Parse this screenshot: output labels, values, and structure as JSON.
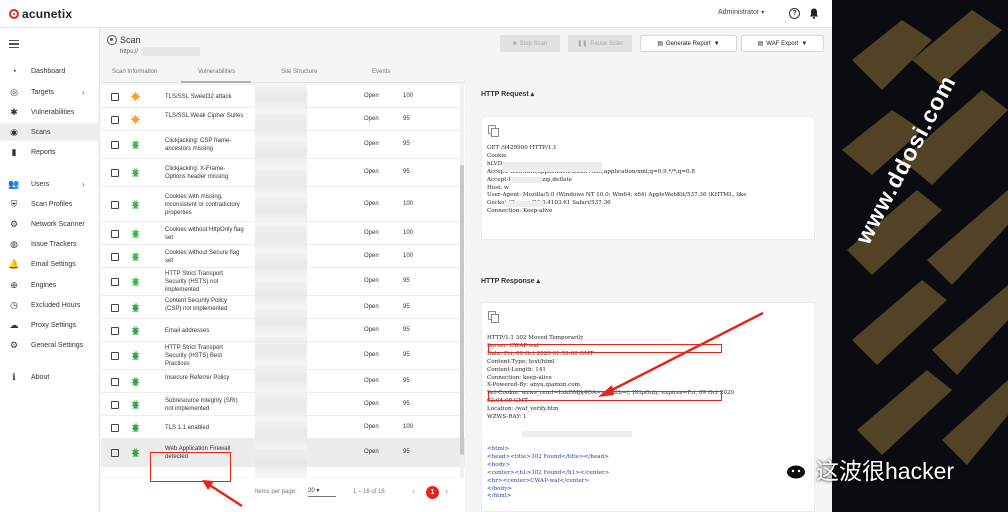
{
  "app": {
    "brand": "acunetix",
    "user": "Administrator",
    "help_glyph": "?"
  },
  "sidebar": {
    "items": [
      {
        "label": "Dashboard",
        "icon": "dashboard-icon",
        "glyph": "◔",
        "chevron": ""
      },
      {
        "label": "Targets",
        "icon": "target-icon",
        "glyph": "◎",
        "chevron": "›"
      },
      {
        "label": "Vulnerabilities",
        "icon": "bug-icon",
        "glyph": "✱",
        "chevron": ""
      },
      {
        "label": "Scans",
        "icon": "radar-icon",
        "glyph": "◉",
        "chevron": "",
        "active": true
      },
      {
        "label": "Reports",
        "icon": "report-icon",
        "glyph": "▮",
        "chevron": ""
      },
      {
        "label": "Users",
        "icon": "users-icon",
        "glyph": "👥",
        "chevron": "›"
      },
      {
        "label": "Scan Profiles",
        "icon": "shield-icon",
        "glyph": "⛨",
        "chevron": ""
      },
      {
        "label": "Network Scanner",
        "icon": "network-icon",
        "glyph": "⚙",
        "chevron": ""
      },
      {
        "label": "Issue Trackers",
        "icon": "issue-icon",
        "glyph": "◍",
        "chevron": ""
      },
      {
        "label": "Email Settings",
        "icon": "bell-icon",
        "glyph": "🔔",
        "chevron": ""
      },
      {
        "label": "Engines",
        "icon": "globe-icon",
        "glyph": "⊕",
        "chevron": ""
      },
      {
        "label": "Excluded Hours",
        "icon": "clock-icon",
        "glyph": "◷",
        "chevron": ""
      },
      {
        "label": "Proxy Settings",
        "icon": "cloud-icon",
        "glyph": "☁",
        "chevron": ""
      },
      {
        "label": "General Settings",
        "icon": "gear-icon",
        "glyph": "⚙",
        "chevron": ""
      },
      {
        "label": "About",
        "icon": "info-icon",
        "glyph": "ℹ",
        "chevron": ""
      }
    ]
  },
  "header": {
    "title": "Scan",
    "url_prefix": "https://",
    "buttons": {
      "stop_scan": "Stop Scan",
      "pause_scan": "Pause Scan",
      "generate_report": "Generate Report",
      "waf_export": "WAF Export"
    }
  },
  "tabs": [
    "Scan Information",
    "Vulnerabilities",
    "Site Structure",
    "Events"
  ],
  "vulnerabilities": [
    {
      "name": "TLS/SSL Sweet32 attack",
      "status": "Open",
      "confidence": "100",
      "severity": "medium"
    },
    {
      "name": "TLS/SSL Weak Cipher Suites",
      "status": "Open",
      "confidence": "95",
      "severity": "medium"
    },
    {
      "name": "Clickjacking: CSP frame-ancestors missing",
      "status": "Open",
      "confidence": "95",
      "severity": "low"
    },
    {
      "name": "Clickjacking: X-Frame-Options header missing",
      "status": "Open",
      "confidence": "95",
      "severity": "low"
    },
    {
      "name": "Cookies with missing, inconsistent or contradictory properties",
      "status": "Open",
      "confidence": "100",
      "severity": "low"
    },
    {
      "name": "Cookies without HttpOnly flag set",
      "status": "Open",
      "confidence": "100",
      "severity": "low"
    },
    {
      "name": "Cookies without Secure flag set",
      "status": "Open",
      "confidence": "100",
      "severity": "low"
    },
    {
      "name": "HTTP Strict Transport Security (HSTS) not implemented",
      "status": "Open",
      "confidence": "95",
      "severity": "low"
    },
    {
      "name": "Content Security Policy (CSP) not implemented",
      "status": "Open",
      "confidence": "95",
      "severity": "info"
    },
    {
      "name": "Email addresses",
      "status": "Open",
      "confidence": "95",
      "severity": "info"
    },
    {
      "name": "HTTP Strict Transport Security (HSTS) Best Practices",
      "status": "Open",
      "confidence": "95",
      "severity": "info"
    },
    {
      "name": "Insecure Referrer Policy",
      "status": "Open",
      "confidence": "95",
      "severity": "info"
    },
    {
      "name": "Subresource Integrity (SRI) not implemented",
      "status": "Open",
      "confidence": "95",
      "severity": "info"
    },
    {
      "name": "TLS 1.1 enabled",
      "status": "Open",
      "confidence": "100",
      "severity": "info"
    },
    {
      "name": "Web Application Firewall detected",
      "status": "Open",
      "confidence": "95",
      "severity": "info",
      "selected": true
    }
  ],
  "pagination": {
    "label": "Items per page:",
    "page_size": "20",
    "range": "1 – 16 of 16",
    "page": "1",
    "prev": "‹",
    "next": "›"
  },
  "request": {
    "title": "HTTP Request",
    "lines": [
      "GET /9429900 HTTP/1.1",
      "Cookie",
      "hLVD_",
      "Accept: text/html,application/xhtml+xml,application/xml;q=0.9,*/*;q=0.8",
      "Accept-Encoding: gzip,deflate",
      "Host: w",
      "User-Agent: Mozilla/5.0 (Windows NT 10.0; Win64; x64) AppleWebKit/537.36 (KHTML, like",
      "Gecko) Chrome/83.0.4103.61 Safari/537.36",
      "Connection: Keep-alive"
    ]
  },
  "response": {
    "title": "HTTP Response",
    "lines": [
      "HTTP/1.1 302 Moved Temporarily",
      "Server: CWAP-waf",
      "Date: Fri, 09 Oct 2020 01:59:00 GMT",
      "Content-Type: text/html",
      "Content-Length: 141",
      "Connection: keep-alive",
      "X-Powered-By: anyu.qianxin.com",
      "Set-Cookie: wzws_reurl=LzkOMjk4OA==; path=/; HttpOnly; expires=Fri, 09 Oct 2020",
      "02:04:00 GMT",
      "Location: /waf_verify.htm",
      "WZWS-RAY: 1"
    ],
    "html_lines": [
      "<html>",
      "<head><title>302 Found</title></head>",
      "<body>",
      "<center><h1>302 Found</h1></center>",
      "<hr><center>CWAP-waf</center>",
      "</body>",
      "</html>"
    ]
  },
  "watermark": {
    "site": "www.ddosi.com",
    "wechat": "这波很hacker"
  },
  "colors": {
    "accent": "#e2261c",
    "medium": "#f5a623",
    "low": "#4caf50",
    "info": "#3ca24a"
  }
}
